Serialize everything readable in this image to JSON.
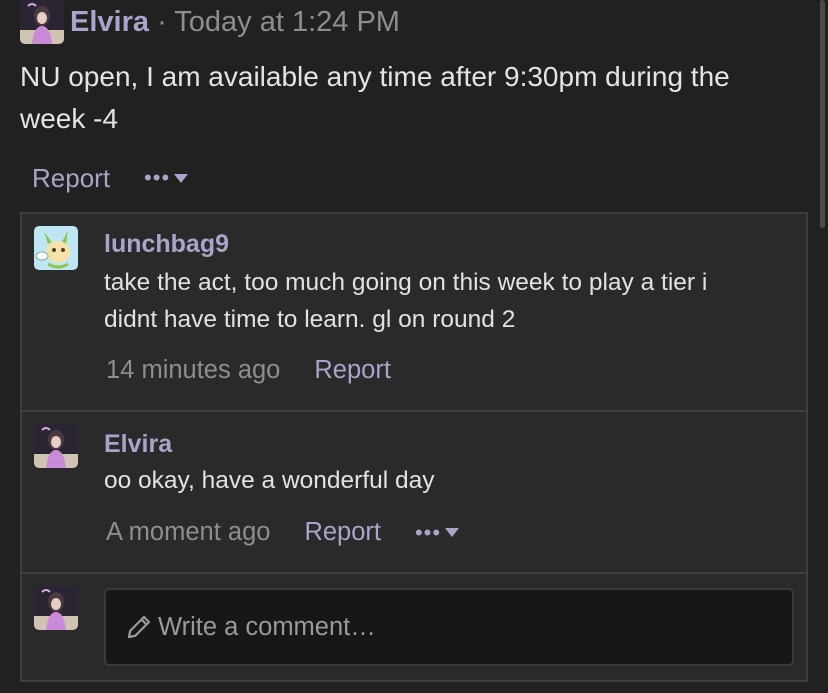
{
  "post": {
    "author": "Elvira",
    "separator": "·",
    "time": "Today at 1:24 PM",
    "body": "NU open, I am available any time after 9:30pm during the week -4",
    "report_label": "Report",
    "more_label": "•••"
  },
  "comments": [
    {
      "author": "lunchbag9",
      "text": "take the act, too much going on this week to play a tier i didnt have time to learn. gl on round 2",
      "time": "14 minutes ago",
      "report_label": "Report"
    },
    {
      "author": "Elvira",
      "text": "oo okay, have a wonderful day",
      "time": "A moment ago",
      "report_label": "Report",
      "more_label": "•••"
    }
  ],
  "compose": {
    "placeholder": "Write a comment…"
  },
  "icons": {
    "author_avatar": "elvira-avatar",
    "commenter_avatar": "leafeon-avatar",
    "compose": "pencil-icon",
    "more": "ellipsis-caret-icon"
  },
  "colors": {
    "background": "#212121",
    "panel": "#2a2a2a",
    "accent": "#a9a4c9",
    "muted": "#8e8e8e"
  }
}
